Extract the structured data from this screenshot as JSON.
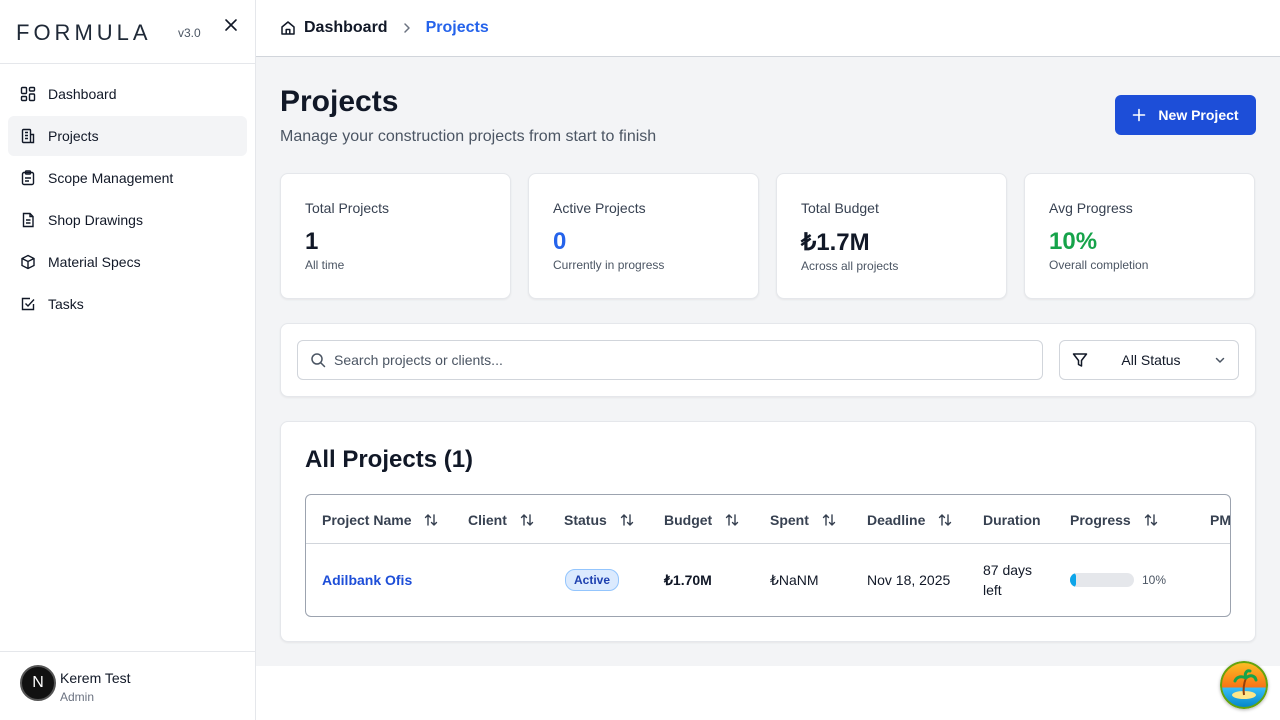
{
  "app": {
    "logo": "FORMULA",
    "version": "v3.0"
  },
  "sidebar": {
    "items": [
      {
        "label": "Dashboard",
        "icon": "dashboard-grid-icon"
      },
      {
        "label": "Projects",
        "icon": "building-icon",
        "active": true
      },
      {
        "label": "Scope Management",
        "icon": "clipboard-icon"
      },
      {
        "label": "Shop Drawings",
        "icon": "document-icon"
      },
      {
        "label": "Material Specs",
        "icon": "package-icon"
      },
      {
        "label": "Tasks",
        "icon": "checkbox-icon"
      }
    ]
  },
  "user": {
    "initial": "N",
    "name": "Kerem Test",
    "role": "Admin"
  },
  "breadcrumb": {
    "home": "Dashboard",
    "current": "Projects"
  },
  "page": {
    "title": "Projects",
    "subtitle": "Manage your construction projects from start to finish",
    "new_button": "New Project"
  },
  "stats": [
    {
      "label": "Total Projects",
      "value": "1",
      "sub": "All time"
    },
    {
      "label": "Active Projects",
      "value": "0",
      "sub": "Currently in progress",
      "color": "#2563eb"
    },
    {
      "label": "Total Budget",
      "value": "₺1.7M",
      "sub": "Across all projects"
    },
    {
      "label": "Avg Progress",
      "value": "10%",
      "sub": "Overall completion",
      "color": "#16a34a"
    }
  ],
  "filters": {
    "search_placeholder": "Search projects or clients...",
    "status_value": "All Status"
  },
  "table": {
    "title": "All Projects (1)",
    "columns": [
      "Project Name",
      "Client",
      "Status",
      "Budget",
      "Spent",
      "Deadline",
      "Duration",
      "Progress",
      "PM"
    ],
    "rows": [
      {
        "name": "Adilbank Ofis",
        "client": "",
        "status": "Active",
        "budget": "₺1.70M",
        "spent": "₺NaNM",
        "deadline": "Nov 18, 2025",
        "duration_line1": "87 days",
        "duration_line2": "left",
        "progress": 10,
        "progress_text": "10%",
        "pm": ""
      }
    ]
  },
  "colors": {
    "accent": "#1d4ed8",
    "link": "#2563eb",
    "success": "#16a34a",
    "progress": "#0ea5e9"
  }
}
